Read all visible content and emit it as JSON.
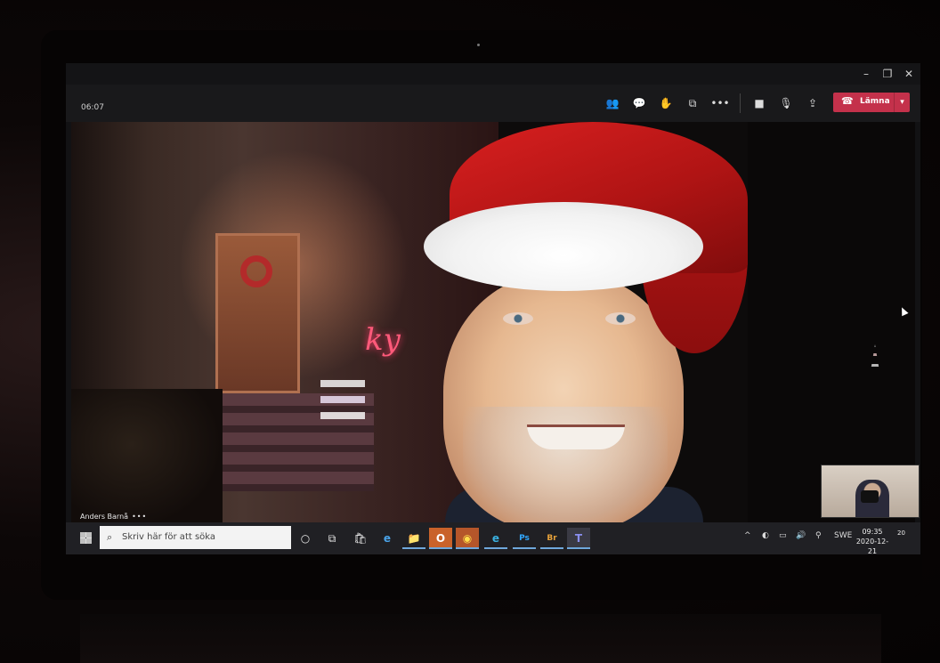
{
  "meeting": {
    "elapsed": "06:07",
    "participant_name": "Anders Barnå",
    "more_label": "•••",
    "leave_label": "Lämna"
  },
  "window_controls": {
    "minimize": "–",
    "maximize": "❐",
    "close": "✕"
  },
  "toolbar_icons": [
    "people-icon",
    "chat-icon",
    "raise-hand-icon",
    "rooms-icon",
    "more-icon",
    "camera-icon",
    "mic-icon",
    "share-icon"
  ],
  "video": {
    "neon_sign": "ky"
  },
  "taskbar": {
    "search_placeholder": "Skriv här för att söka",
    "pinned": [
      {
        "name": "cortana",
        "glyph": "○"
      },
      {
        "name": "task-view",
        "glyph": "⧉"
      },
      {
        "name": "store",
        "glyph": "🛍"
      },
      {
        "name": "ie",
        "glyph": "e"
      },
      {
        "name": "explorer",
        "glyph": "📁"
      },
      {
        "name": "outlook",
        "glyph": "O"
      },
      {
        "name": "chrome",
        "glyph": "◉"
      },
      {
        "name": "edge",
        "glyph": "e"
      },
      {
        "name": "photoshop",
        "glyph": "Ps"
      },
      {
        "name": "bridge",
        "glyph": "Br"
      },
      {
        "name": "teams",
        "glyph": "T"
      }
    ],
    "tray": {
      "language": "SWE",
      "time": "09:35",
      "date": "2020-12-21",
      "notifications": "20"
    }
  },
  "colors": {
    "leave": "#c4314b",
    "taskbar": "#202024",
    "meeting_bar": "#19191b"
  }
}
